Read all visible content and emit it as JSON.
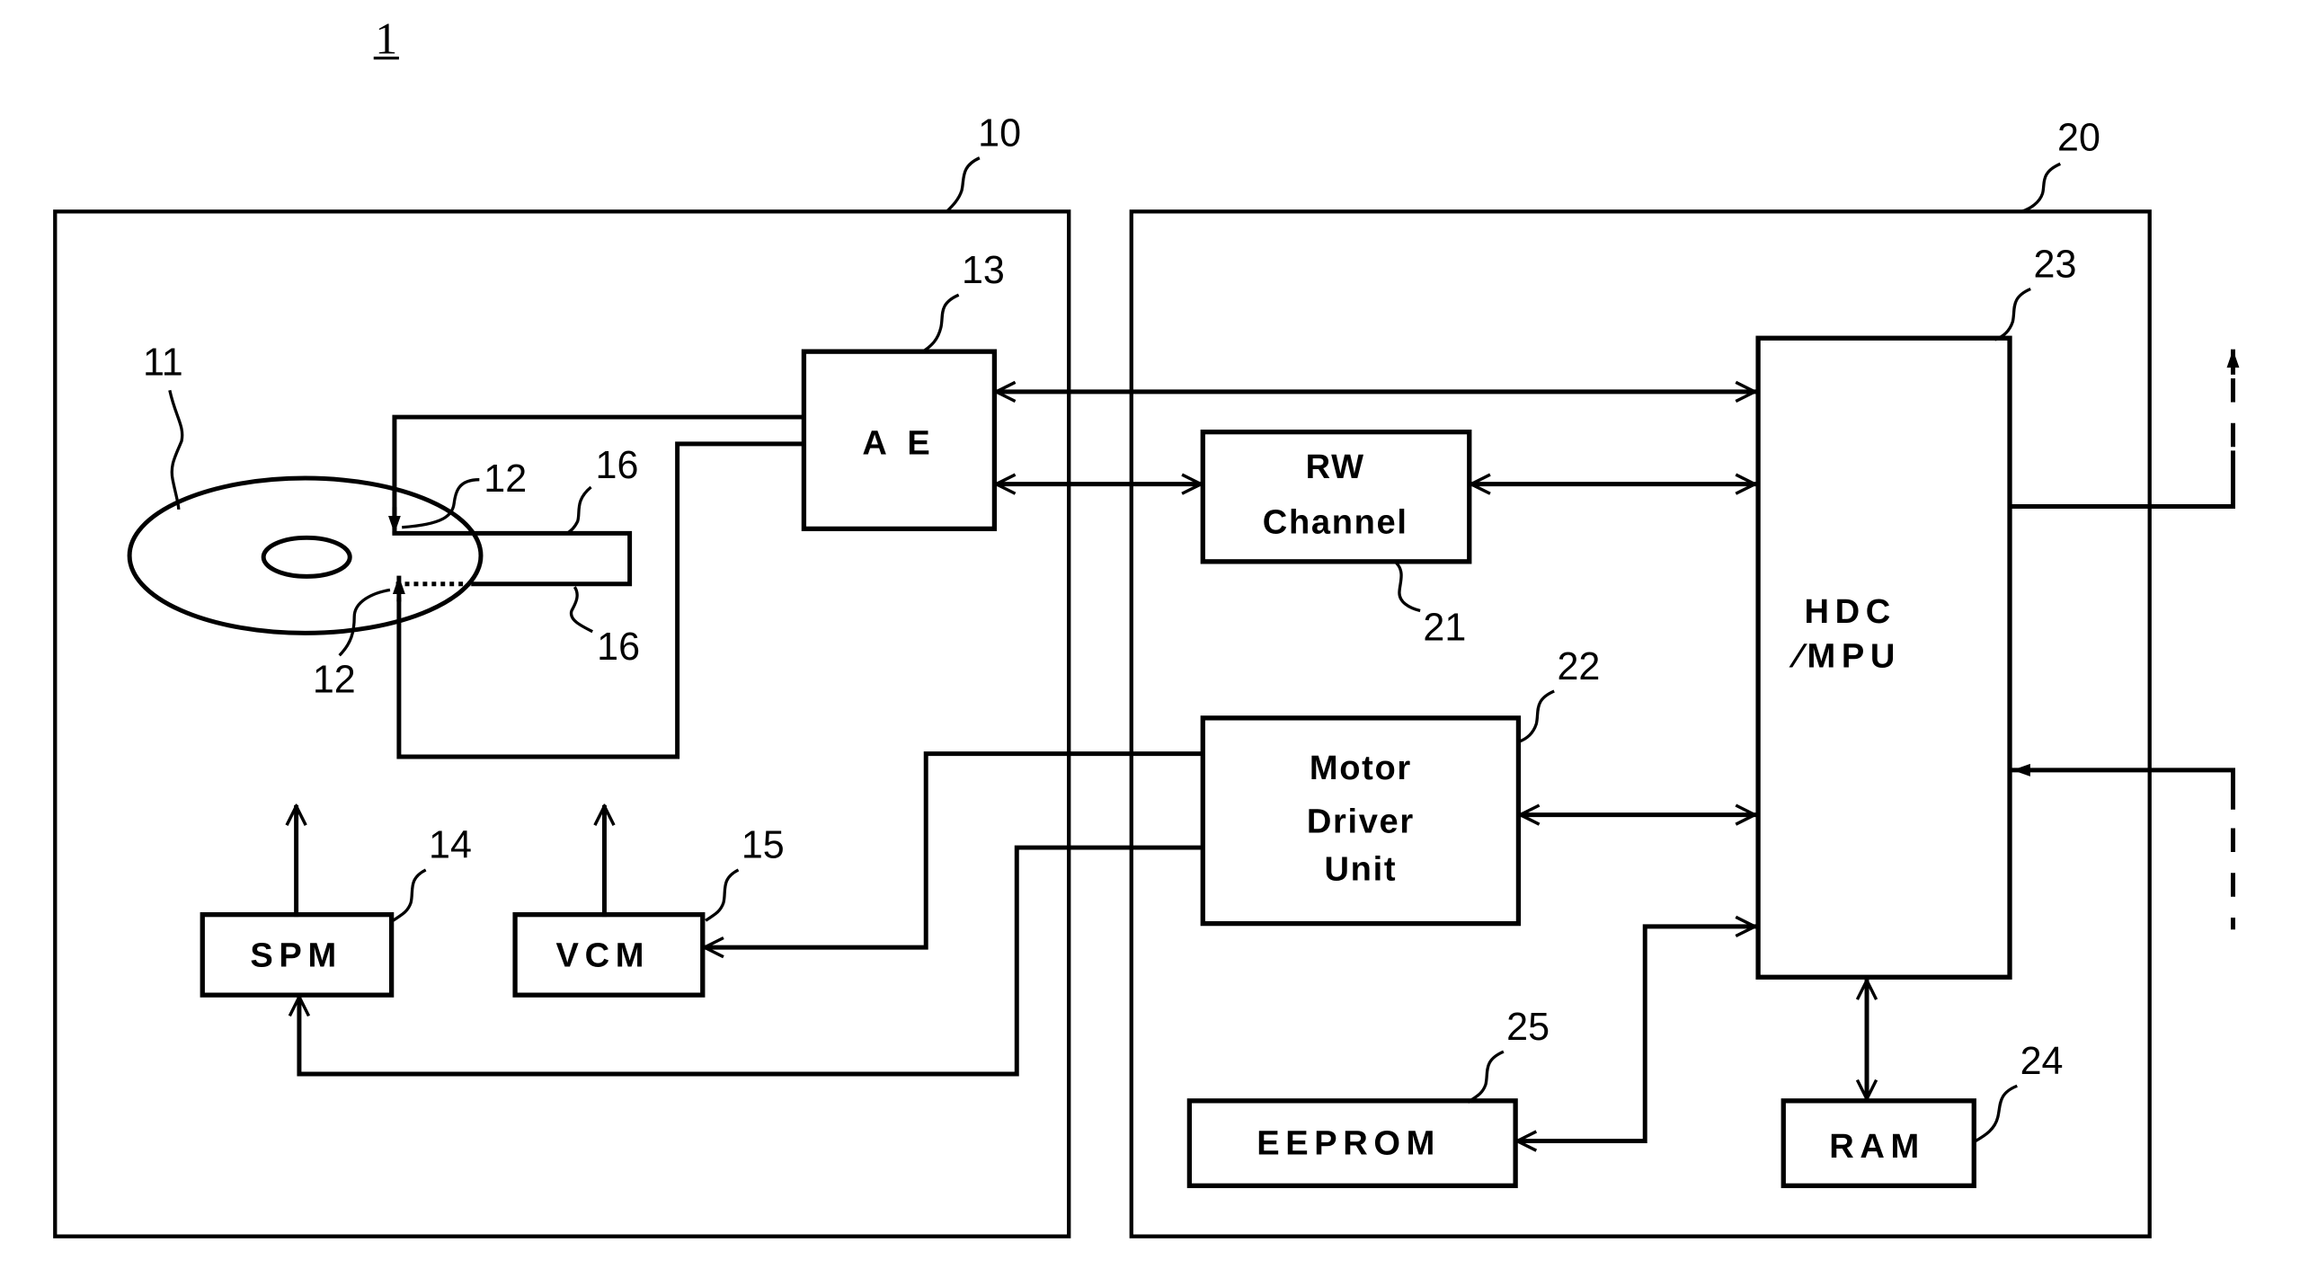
{
  "figure_label": "1",
  "blocks": {
    "head_disk_assembly": {
      "ref": "10"
    },
    "control_circuit": {
      "ref": "20"
    },
    "magnetic_disk": {
      "ref": "11"
    },
    "head_top": {
      "ref": "12"
    },
    "head_bottom": {
      "ref": "12"
    },
    "arm_top": {
      "ref": "16"
    },
    "arm_bottom": {
      "ref": "16"
    },
    "ae": {
      "ref": "13",
      "label": "A E"
    },
    "spm": {
      "ref": "14",
      "label": "SPM"
    },
    "vcm": {
      "ref": "15",
      "label": "VCM"
    },
    "rw_channel": {
      "ref": "21",
      "label_line1": "RW",
      "label_line2": "Channel"
    },
    "motor_driver": {
      "ref": "22",
      "label_line1": "Motor",
      "label_line2": "Driver",
      "label_line3": "Unit"
    },
    "hdc_mpu": {
      "ref": "23",
      "label_line1": "HDC",
      "label_line2": "∕MPU"
    },
    "ram": {
      "ref": "24",
      "label": "RAM"
    },
    "eeprom": {
      "ref": "25",
      "label": "EEPROM"
    }
  },
  "connections": [
    {
      "from": "ae",
      "to": "hdc_mpu",
      "type": "bidirectional"
    },
    {
      "from": "ae",
      "to": "rw_channel",
      "type": "bidirectional"
    },
    {
      "from": "rw_channel",
      "to": "hdc_mpu",
      "type": "bidirectional"
    },
    {
      "from": "motor_driver",
      "to": "hdc_mpu",
      "type": "bidirectional"
    },
    {
      "from": "motor_driver",
      "to": "vcm",
      "type": "directed"
    },
    {
      "from": "motor_driver",
      "to": "spm",
      "type": "directed"
    },
    {
      "from": "hdc_mpu",
      "to": "eeprom",
      "type": "bidirectional"
    },
    {
      "from": "hdc_mpu",
      "to": "ram",
      "type": "bidirectional"
    },
    {
      "from": "ae",
      "to": "head_top",
      "type": "directed"
    },
    {
      "from": "ae",
      "to": "head_bottom",
      "type": "directed-dotted"
    },
    {
      "from": "hdc_mpu",
      "to": "host",
      "type": "directed-dashed"
    },
    {
      "from": "host",
      "to": "hdc_mpu",
      "type": "directed-dashed"
    }
  ]
}
